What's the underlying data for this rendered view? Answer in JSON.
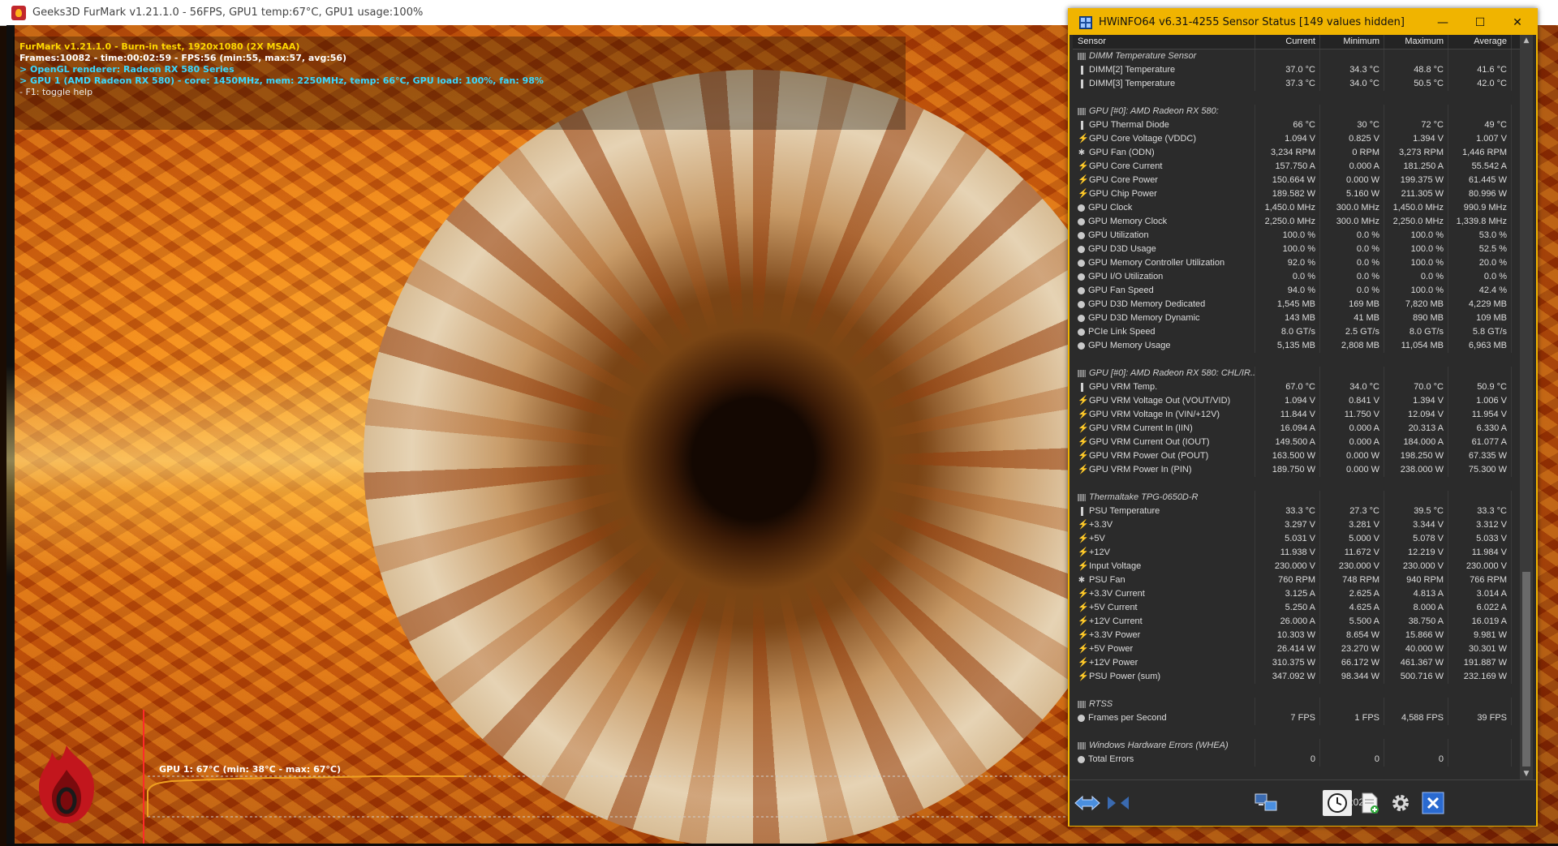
{
  "furmark": {
    "window_title": "Geeks3D FurMark v1.21.1.0 - 56FPS, GPU1 temp:67°C, GPU1 usage:100%",
    "osd": {
      "line1": "FurMark v1.21.1.0 - Burn-in test, 1920x1080 (2X MSAA)",
      "line2": "Frames:10082 - time:00:02:59 - FPS:56 (min:55, max:57, avg:56)",
      "line3": "> OpenGL renderer: Radeon RX 580 Series",
      "line4": "> GPU 1 (AMD Radeon RX 580) - core: 1450MHz, mem: 2250MHz, temp: 66°C, GPU load: 100%, fan: 98%",
      "line5": "- F1: toggle help"
    },
    "graph_label": "GPU 1: 67°C (min: 38°C - max: 67°C)",
    "colors": {
      "osd_yellow": "#ffd800",
      "osd_cyan": "#3ad8ff",
      "graph_line": "#f0a020"
    }
  },
  "hwinfo": {
    "window_title": "HWiNFO64 v6.31-4255 Sensor Status [149 values hidden]",
    "columns": [
      "Sensor",
      "Current",
      "Minimum",
      "Maximum",
      "Average"
    ],
    "rows": [
      {
        "kind": "group",
        "name": "DIMM Temperature Sensor"
      },
      {
        "kind": "sensor",
        "icon": "temp",
        "name": "DIMM[2] Temperature",
        "cur": "37.0 °C",
        "min": "34.3 °C",
        "max": "48.8 °C",
        "avg": "41.6 °C"
      },
      {
        "kind": "sensor",
        "icon": "temp",
        "name": "DIMM[3] Temperature",
        "cur": "37.3 °C",
        "min": "34.0 °C",
        "max": "50.5 °C",
        "avg": "42.0 °C"
      },
      {
        "kind": "blank"
      },
      {
        "kind": "group",
        "name": "GPU [#0]: AMD Radeon RX 580:"
      },
      {
        "kind": "sensor",
        "icon": "temp",
        "name": "GPU Thermal Diode",
        "cur": "66 °C",
        "min": "30 °C",
        "max": "72 °C",
        "avg": "49 °C"
      },
      {
        "kind": "sensor",
        "icon": "volt",
        "name": "GPU Core Voltage (VDDC)",
        "cur": "1.094 V",
        "min": "0.825 V",
        "max": "1.394 V",
        "avg": "1.007 V"
      },
      {
        "kind": "sensor",
        "icon": "fan",
        "name": "GPU Fan (ODN)",
        "cur": "3,234 RPM",
        "min": "0 RPM",
        "max": "3,273 RPM",
        "avg": "1,446 RPM"
      },
      {
        "kind": "sensor",
        "icon": "volt",
        "name": "GPU Core Current",
        "cur": "157.750 A",
        "min": "0.000 A",
        "max": "181.250 A",
        "avg": "55.542 A"
      },
      {
        "kind": "sensor",
        "icon": "volt",
        "name": "GPU Core Power",
        "cur": "150.664 W",
        "min": "0.000 W",
        "max": "199.375 W",
        "avg": "61.445 W"
      },
      {
        "kind": "sensor",
        "icon": "volt",
        "name": "GPU Chip Power",
        "cur": "189.582 W",
        "min": "5.160 W",
        "max": "211.305 W",
        "avg": "80.996 W"
      },
      {
        "kind": "sensor",
        "icon": "clock",
        "name": "GPU Clock",
        "cur": "1,450.0 MHz",
        "min": "300.0 MHz",
        "max": "1,450.0 MHz",
        "avg": "990.9 MHz"
      },
      {
        "kind": "sensor",
        "icon": "clock",
        "name": "GPU Memory Clock",
        "cur": "2,250.0 MHz",
        "min": "300.0 MHz",
        "max": "2,250.0 MHz",
        "avg": "1,339.8 MHz"
      },
      {
        "kind": "sensor",
        "icon": "clock",
        "name": "GPU Utilization",
        "cur": "100.0 %",
        "min": "0.0 %",
        "max": "100.0 %",
        "avg": "53.0 %"
      },
      {
        "kind": "sensor",
        "icon": "clock",
        "name": "GPU D3D Usage",
        "cur": "100.0 %",
        "min": "0.0 %",
        "max": "100.0 %",
        "avg": "52.5 %"
      },
      {
        "kind": "sensor",
        "icon": "clock",
        "name": "GPU Memory Controller Utilization",
        "cur": "92.0 %",
        "min": "0.0 %",
        "max": "100.0 %",
        "avg": "20.0 %"
      },
      {
        "kind": "sensor",
        "icon": "clock",
        "name": "GPU I/O Utilization",
        "cur": "0.0 %",
        "min": "0.0 %",
        "max": "0.0 %",
        "avg": "0.0 %"
      },
      {
        "kind": "sensor",
        "icon": "clock",
        "name": "GPU Fan Speed",
        "cur": "94.0 %",
        "min": "0.0 %",
        "max": "100.0 %",
        "avg": "42.4 %"
      },
      {
        "kind": "sensor",
        "icon": "clock",
        "name": "GPU D3D Memory Dedicated",
        "cur": "1,545 MB",
        "min": "169 MB",
        "max": "7,820 MB",
        "avg": "4,229 MB"
      },
      {
        "kind": "sensor",
        "icon": "clock",
        "name": "GPU D3D Memory Dynamic",
        "cur": "143 MB",
        "min": "41 MB",
        "max": "890 MB",
        "avg": "109 MB"
      },
      {
        "kind": "sensor",
        "icon": "clock",
        "name": "PCIe Link Speed",
        "cur": "8.0 GT/s",
        "min": "2.5 GT/s",
        "max": "8.0 GT/s",
        "avg": "5.8 GT/s"
      },
      {
        "kind": "sensor",
        "icon": "clock",
        "name": "GPU Memory Usage",
        "cur": "5,135 MB",
        "min": "2,808 MB",
        "max": "11,054 MB",
        "avg": "6,963 MB"
      },
      {
        "kind": "blank"
      },
      {
        "kind": "group",
        "name": "GPU [#0]: AMD Radeon RX 580: CHL/IR..."
      },
      {
        "kind": "sensor",
        "icon": "temp",
        "name": "GPU VRM Temp.",
        "cur": "67.0 °C",
        "min": "34.0 °C",
        "max": "70.0 °C",
        "avg": "50.9 °C"
      },
      {
        "kind": "sensor",
        "icon": "volt",
        "name": "GPU VRM Voltage Out (VOUT/VID)",
        "cur": "1.094 V",
        "min": "0.841 V",
        "max": "1.394 V",
        "avg": "1.006 V"
      },
      {
        "kind": "sensor",
        "icon": "volt",
        "name": "GPU VRM Voltage In (VIN/+12V)",
        "cur": "11.844 V",
        "min": "11.750 V",
        "max": "12.094 V",
        "avg": "11.954 V"
      },
      {
        "kind": "sensor",
        "icon": "volt",
        "name": "GPU VRM Current In (IIN)",
        "cur": "16.094 A",
        "min": "0.000 A",
        "max": "20.313 A",
        "avg": "6.330 A"
      },
      {
        "kind": "sensor",
        "icon": "volt",
        "name": "GPU VRM Current Out (IOUT)",
        "cur": "149.500 A",
        "min": "0.000 A",
        "max": "184.000 A",
        "avg": "61.077 A"
      },
      {
        "kind": "sensor",
        "icon": "volt",
        "name": "GPU VRM Power Out (POUT)",
        "cur": "163.500 W",
        "min": "0.000 W",
        "max": "198.250 W",
        "avg": "67.335 W"
      },
      {
        "kind": "sensor",
        "icon": "volt",
        "name": "GPU VRM Power In (PIN)",
        "cur": "189.750 W",
        "min": "0.000 W",
        "max": "238.000 W",
        "avg": "75.300 W"
      },
      {
        "kind": "blank"
      },
      {
        "kind": "group",
        "name": "Thermaltake TPG-0650D-R"
      },
      {
        "kind": "sensor",
        "icon": "temp",
        "name": "PSU Temperature",
        "cur": "33.3 °C",
        "min": "27.3 °C",
        "max": "39.5 °C",
        "avg": "33.3 °C"
      },
      {
        "kind": "sensor",
        "icon": "volt",
        "name": "+3.3V",
        "cur": "3.297 V",
        "min": "3.281 V",
        "max": "3.344 V",
        "avg": "3.312 V"
      },
      {
        "kind": "sensor",
        "icon": "volt",
        "name": "+5V",
        "cur": "5.031 V",
        "min": "5.000 V",
        "max": "5.078 V",
        "avg": "5.033 V"
      },
      {
        "kind": "sensor",
        "icon": "volt",
        "name": "+12V",
        "cur": "11.938 V",
        "min": "11.672 V",
        "max": "12.219 V",
        "avg": "11.984 V"
      },
      {
        "kind": "sensor",
        "icon": "volt",
        "name": "Input Voltage",
        "cur": "230.000 V",
        "min": "230.000 V",
        "max": "230.000 V",
        "avg": "230.000 V"
      },
      {
        "kind": "sensor",
        "icon": "fan",
        "name": "PSU Fan",
        "cur": "760 RPM",
        "min": "748 RPM",
        "max": "940 RPM",
        "avg": "766 RPM"
      },
      {
        "kind": "sensor",
        "icon": "volt",
        "name": "+3.3V Current",
        "cur": "3.125 A",
        "min": "2.625 A",
        "max": "4.813 A",
        "avg": "3.014 A"
      },
      {
        "kind": "sensor",
        "icon": "volt",
        "name": "+5V Current",
        "cur": "5.250 A",
        "min": "4.625 A",
        "max": "8.000 A",
        "avg": "6.022 A"
      },
      {
        "kind": "sensor",
        "icon": "volt",
        "name": "+12V Current",
        "cur": "26.000 A",
        "min": "5.500 A",
        "max": "38.750 A",
        "avg": "16.019 A"
      },
      {
        "kind": "sensor",
        "icon": "volt",
        "name": "+3.3V Power",
        "cur": "10.303 W",
        "min": "8.654 W",
        "max": "15.866 W",
        "avg": "9.981 W"
      },
      {
        "kind": "sensor",
        "icon": "volt",
        "name": "+5V Power",
        "cur": "26.414 W",
        "min": "23.270 W",
        "max": "40.000 W",
        "avg": "30.301 W"
      },
      {
        "kind": "sensor",
        "icon": "volt",
        "name": "+12V Power",
        "cur": "310.375 W",
        "min": "66.172 W",
        "max": "461.367 W",
        "avg": "191.887 W"
      },
      {
        "kind": "sensor",
        "icon": "volt",
        "name": "PSU Power (sum)",
        "cur": "347.092 W",
        "min": "98.344 W",
        "max": "500.716 W",
        "avg": "232.169 W"
      },
      {
        "kind": "blank"
      },
      {
        "kind": "group",
        "name": "RTSS"
      },
      {
        "kind": "sensor",
        "icon": "clock",
        "name": "Frames per Second",
        "cur": "7 FPS",
        "min": "1 FPS",
        "max": "4,588 FPS",
        "avg": "39 FPS"
      },
      {
        "kind": "blank"
      },
      {
        "kind": "group",
        "name": "Windows Hardware Errors (WHEA)"
      },
      {
        "kind": "sensor",
        "icon": "clock",
        "name": "Total Errors",
        "cur": "0",
        "min": "0",
        "max": "0",
        "avg": ""
      }
    ],
    "status_time": "24:02:50",
    "colors": {
      "title_bg": "#f0b400",
      "grid_bg": "#2b2b2b",
      "text": "#dcdcdc"
    }
  }
}
